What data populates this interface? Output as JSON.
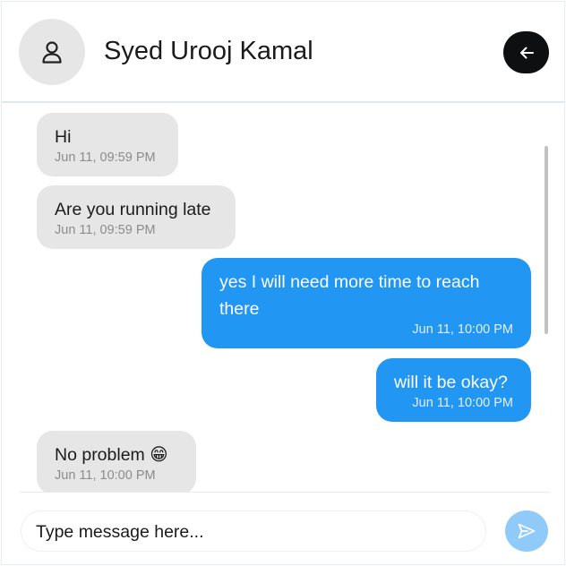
{
  "header": {
    "contact_name": "Syed Urooj Kamal",
    "avatar_icon": "user-icon",
    "back_icon": "arrow-left-icon"
  },
  "messages": [
    {
      "direction": "in",
      "text": "Hi",
      "time": "Jun 11, 09:59 PM"
    },
    {
      "direction": "in",
      "text": "Are you running late",
      "time": "Jun 11, 09:59 PM"
    },
    {
      "direction": "out",
      "text_lines": [
        "yes I will need more time to reach",
        "there"
      ],
      "time": "Jun 11, 10:00 PM"
    },
    {
      "direction": "out",
      "text": "will it be okay?",
      "time": "Jun 11, 10:00 PM"
    },
    {
      "direction": "in",
      "text": "No problem 😁",
      "time": "Jun 11, 10:00 PM"
    }
  ],
  "composer": {
    "placeholder": "Type message here...",
    "send_icon": "send-icon"
  },
  "colors": {
    "incoming_bubble": "#e6e6e6",
    "outgoing_bubble": "#2196f3",
    "send_button": "#90caf9",
    "back_button": "#0e0f11"
  }
}
